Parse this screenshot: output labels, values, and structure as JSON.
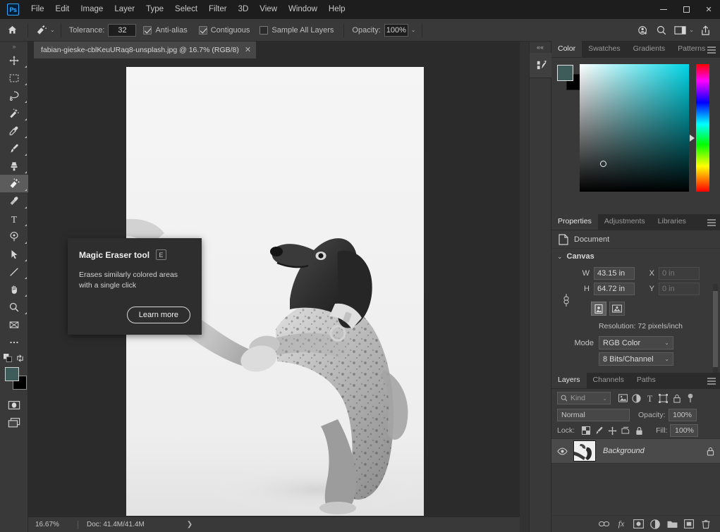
{
  "app": {
    "name": "Adobe Photoshop",
    "logo_text": "Ps"
  },
  "menubar": {
    "items": [
      "File",
      "Edit",
      "Image",
      "Layer",
      "Type",
      "Select",
      "Filter",
      "3D",
      "View",
      "Window",
      "Help"
    ]
  },
  "window_controls": {
    "minimize": "minimize-button",
    "maximize": "maximize-button",
    "close": "✕"
  },
  "options_bar": {
    "home_icon": "home-icon",
    "active_tool_icon": "magic-eraser-icon",
    "preset_caret": "⌄",
    "tolerance_label": "Tolerance:",
    "tolerance_value": "32",
    "antialias_label": "Anti-alias",
    "antialias_checked": true,
    "contiguous_label": "Contiguous",
    "contiguous_checked": true,
    "sample_all_layers_label": "Sample All Layers",
    "sample_all_layers_checked": false,
    "opacity_label": "Opacity:",
    "opacity_value": "100%",
    "opacity_caret": "⌄",
    "right_icons": [
      "share-collaborate-icon",
      "search-icon",
      "workspace-icon",
      "share-export-icon"
    ]
  },
  "toolbar": {
    "grip": "⋮⋮",
    "tools": [
      {
        "name": "move-tool",
        "label": "Move tool"
      },
      {
        "name": "rectangular-marquee-tool",
        "label": "Rectangular Marquee tool"
      },
      {
        "name": "lasso-tool",
        "label": "Lasso tool"
      },
      {
        "name": "magic-wand-tool",
        "label": "Object Selection / Magic Wand tool"
      },
      {
        "name": "eyedropper-tool",
        "label": "Eyedropper tool"
      },
      {
        "name": "brush-tool",
        "label": "Brush tool"
      },
      {
        "name": "clone-stamp-tool",
        "label": "Clone Stamp tool"
      },
      {
        "name": "magic-eraser-tool",
        "label": "Magic Eraser tool",
        "selected": true
      },
      {
        "name": "gradient-tool",
        "label": "Gradient tool"
      },
      {
        "name": "type-tool",
        "label": "Horizontal Type tool"
      },
      {
        "name": "pen-tool",
        "label": "Pen tool"
      },
      {
        "name": "path-selection-tool",
        "label": "Path Selection tool"
      },
      {
        "name": "line-tool",
        "label": "Line tool"
      },
      {
        "name": "hand-tool",
        "label": "Hand tool"
      },
      {
        "name": "zoom-tool",
        "label": "Zoom tool"
      },
      {
        "name": "edit-toolbar-tool",
        "label": "Edit Toolbar"
      },
      {
        "name": "more-tools",
        "label": "More tools"
      }
    ],
    "foreground_color": "#3d5c5a",
    "background_color": "#000000",
    "quick_mask_label": "Edit in Quick Mask Mode",
    "screen_mode_label": "Change Screen Mode"
  },
  "document": {
    "tab_title": "fabian-gieske-cblKeuURaq8-unsplash.jpg @ 16.7% (RGB/8)",
    "tab_close": "✕"
  },
  "status_bar": {
    "zoom": "16.67%",
    "doc_info": "Doc: 41.4M/41.4M",
    "chevron": "❯"
  },
  "collapsed_strip": {
    "expand_arrows": "««",
    "button_icon": "history-brush-icon"
  },
  "color_panel": {
    "tabs": [
      {
        "label": "Color",
        "active": true
      },
      {
        "label": "Swatches",
        "active": false
      },
      {
        "label": "Gradients",
        "active": false
      },
      {
        "label": "Patterns",
        "active": false
      }
    ],
    "menu_icon": "panel-menu-icon",
    "foreground_color": "#3d5c5a",
    "background_color": "#000000",
    "picker_hue": "#00d6e6"
  },
  "properties_panel": {
    "tabs": [
      {
        "label": "Properties",
        "active": true
      },
      {
        "label": "Adjustments",
        "active": false
      },
      {
        "label": "Libraries",
        "active": false
      }
    ],
    "menu_icon": "panel-menu-icon",
    "document_row_label": "Document",
    "document_icon": "document-icon",
    "section_title": "Canvas",
    "section_caret": "⌄",
    "width_label": "W",
    "width_value": "43.15 in",
    "height_label": "H",
    "height_value": "64.72 in",
    "x_label": "X",
    "x_value": "0 in",
    "y_label": "Y",
    "y_value": "0 in",
    "link_icon": "link-chain-icon",
    "portrait_button": "portrait-orientation-icon",
    "landscape_button": "landscape-orientation-icon",
    "resolution_text": "Resolution: 72 pixels/inch",
    "mode_label": "Mode",
    "color_mode_value": "RGB Color",
    "bit_depth_value": "8 Bits/Channel",
    "caret": "⌄"
  },
  "layers_panel": {
    "tabs": [
      {
        "label": "Layers",
        "active": true
      },
      {
        "label": "Channels",
        "active": false
      },
      {
        "label": "Paths",
        "active": false
      }
    ],
    "menu_icon": "panel-menu-icon",
    "filter_search_icon": "search-icon",
    "filter_kind_value": "Kind",
    "filter_caret": "⌄",
    "filter_icons": [
      "pixel-layer-filter-icon",
      "adjustment-layer-filter-icon",
      "type-layer-filter-icon",
      "shape-layer-filter-icon",
      "smart-object-filter-icon"
    ],
    "filter_toggle": "filter-toggle-icon",
    "blend_mode": "Normal",
    "opacity_label": "Opacity:",
    "opacity_value": "100%",
    "lock_label": "Lock:",
    "lock_icons": [
      "lock-transparency-icon",
      "lock-image-pixels-icon",
      "lock-position-icon",
      "lock-artboard-nesting-icon",
      "lock-all-icon"
    ],
    "fill_label": "Fill:",
    "fill_value": "100%",
    "layers": [
      {
        "name": "Background",
        "visible": true,
        "locked": true,
        "eye_icon": "eye-icon",
        "lock_icon": "lock-icon"
      }
    ],
    "footer_icons": [
      "link-layers-icon",
      "layer-style-fx-icon",
      "add-mask-icon",
      "adjustment-layer-icon",
      "new-group-icon",
      "new-layer-icon",
      "delete-layer-icon"
    ],
    "fx_label": "fx"
  },
  "tooltip": {
    "title": "Magic Eraser tool",
    "shortcut": "E",
    "description": "Erases similarly colored areas with a single click",
    "button_label": "Learn more"
  }
}
